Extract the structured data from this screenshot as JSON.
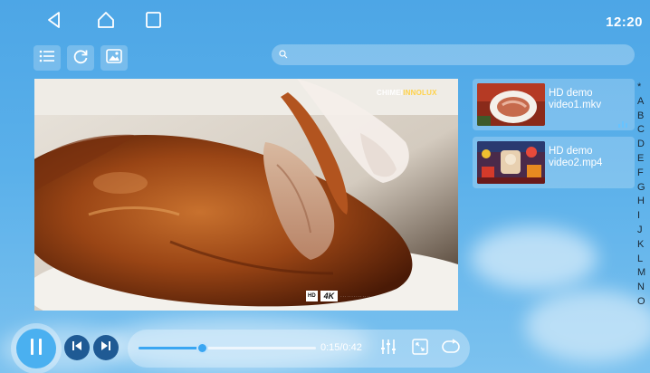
{
  "status_bar": {
    "time": "12:20",
    "nav": [
      "back-icon",
      "home-icon",
      "recent-apps-icon"
    ]
  },
  "toolbar": {
    "icons": [
      "list-icon",
      "refresh-icon",
      "image-icon"
    ]
  },
  "search": {
    "placeholder": "",
    "value": ""
  },
  "video": {
    "brand_prefix": "CHIMEI",
    "brand_accent": "INNOLUX",
    "logo_hd": "HD",
    "logo_4k": "4K"
  },
  "playlist": {
    "items": [
      {
        "title": "HD demo video1.mkv",
        "playing": true
      },
      {
        "title": "HD demo video2.mp4",
        "playing": false
      }
    ]
  },
  "alphabet": [
    "*",
    "A",
    "B",
    "C",
    "D",
    "E",
    "F",
    "G",
    "H",
    "I",
    "J",
    "K",
    "L",
    "M",
    "N",
    "O"
  ],
  "player": {
    "time_display": "0:15/0:42",
    "progress": 0.357
  },
  "colors": {
    "background": "#5ab0ea",
    "accent": "#3aa6f2",
    "skip_button": "#1f5a94",
    "brand_accent": "#ffd24a"
  }
}
